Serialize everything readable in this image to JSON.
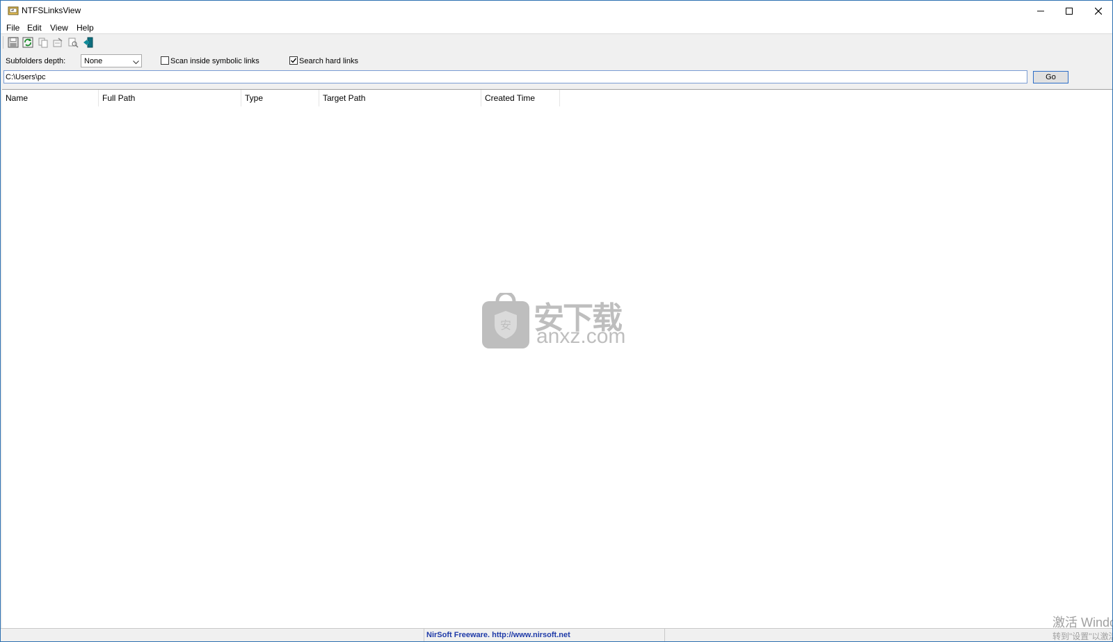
{
  "window": {
    "title": "NTFSLinksView"
  },
  "menu": {
    "items": [
      {
        "label": "File"
      },
      {
        "label": "Edit"
      },
      {
        "label": "View"
      },
      {
        "label": "Help"
      }
    ]
  },
  "toolbar": {
    "buttons": [
      {
        "icon": "save-icon"
      },
      {
        "icon": "refresh-icon"
      },
      {
        "icon": "copy-icon"
      },
      {
        "icon": "properties-icon"
      },
      {
        "icon": "find-icon"
      },
      {
        "icon": "exit-icon"
      }
    ]
  },
  "options": {
    "depth_label": "Subfolders depth:",
    "depth_value": "None",
    "scan_symbolic_label": "Scan inside symbolic links",
    "scan_symbolic_checked": false,
    "search_hard_label": "Search hard links",
    "search_hard_checked": true
  },
  "path": {
    "value": "C:\\Users\\pc",
    "go_label": "Go"
  },
  "columns": [
    "Name",
    "Full Path",
    "Type",
    "Target Path",
    "Created Time"
  ],
  "watermark": {
    "line1": "安下载",
    "line2": "anxz.com"
  },
  "status": {
    "text": "NirSoft Freeware.  http://www.nirsoft.net"
  },
  "os_overlay": {
    "line1": "激活 Windows",
    "line2": "转到\"设置\"以激活"
  },
  "colors": {
    "status_link": "#1e3aa8",
    "window_border": "#2b6fb0",
    "go_border": "#2c6dc7"
  }
}
